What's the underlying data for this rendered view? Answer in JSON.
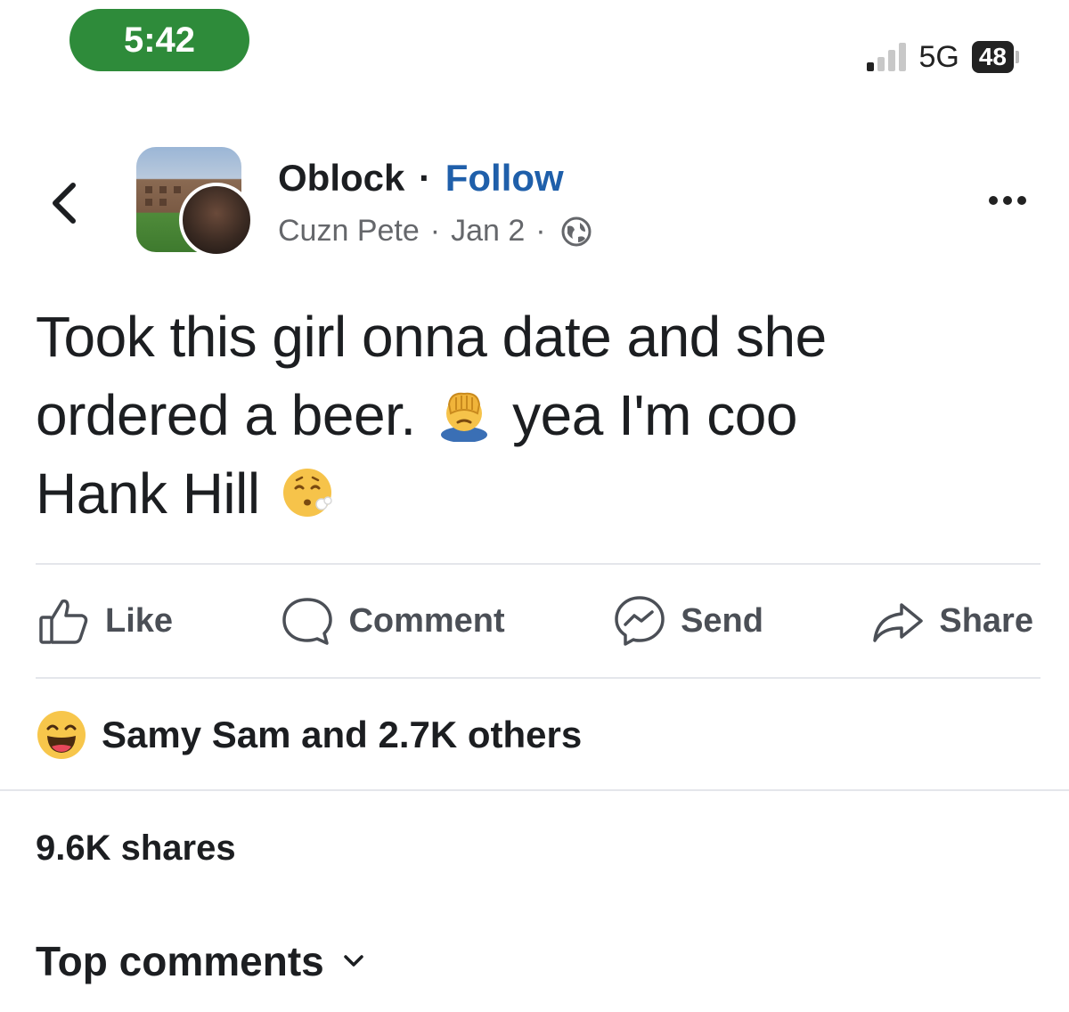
{
  "status_bar": {
    "time": "5:42",
    "network": "5G",
    "battery": "48"
  },
  "post_header": {
    "page_name": "Oblock",
    "separator": "·",
    "follow_label": "Follow",
    "author": "Cuzn Pete",
    "date": "Jan 2",
    "icons": [
      "back-chevron-icon",
      "globe-icon",
      "more-options-icon"
    ]
  },
  "post": {
    "line1": "Took this girl onna date and she",
    "line2_a": "ordered a beer.",
    "line2_b": "yea I'm coo",
    "line3": "Hank Hill",
    "emojis": [
      "facepalm-emoji",
      "exhale-face-emoji"
    ]
  },
  "actions": {
    "like": "Like",
    "comment": "Comment",
    "send": "Send",
    "share": "Share"
  },
  "engagement": {
    "reactions_text": "Samy Sam and 2.7K others",
    "shares_text": "9.6K shares",
    "top_comments_label": "Top comments"
  },
  "colors": {
    "time_pill": "#2e8b3a",
    "follow_link": "#1f5faa",
    "meta_gray": "#65676b"
  }
}
